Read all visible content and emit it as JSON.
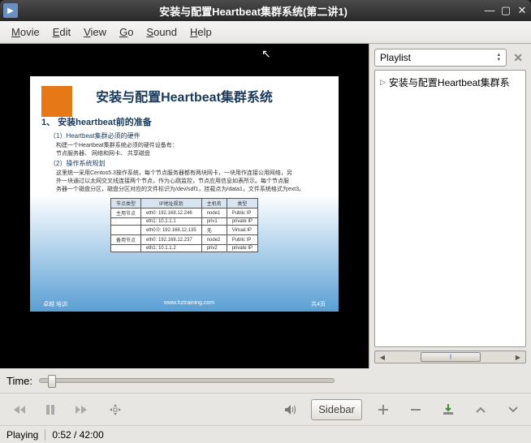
{
  "window": {
    "title": "安装与配置Heartbeat集群系统(第二讲1)"
  },
  "menu": {
    "movie": "Movie",
    "edit": "Edit",
    "view": "View",
    "go": "Go",
    "sound": "Sound",
    "help": "Help"
  },
  "slide": {
    "title": "安装与配置Heartbeat集群系统",
    "h1": "1、 安装heartbeat前的准备",
    "sec1": "（1）Heartbeat集群必须的硬件",
    "sec1_p": "构建一个Heartbeat集群系统必须的硬件设备有：",
    "sec1_p2": "节点服务器、 网络和网卡、 共享磁盘",
    "sec2": "（2）操作系统规划",
    "sec2_p1": "这里统一采用Centos5.3操作系统，每个节点服务器都有两块网卡，一块用作连接公用网络，另",
    "sec2_p2": "外一块通过以太网交叉线连接两个节点，作为心跳监控，节点应用信息如表所示。每个节点服",
    "sec2_p3": "务器一个磁盘分区，磁盘分区对应的文件标识为/dev/sdf1，挂载点为/data1，文件系统格式为ext3。",
    "table": {
      "headers": [
        "节点类型",
        "IP地址规划",
        "主机名",
        "类型"
      ],
      "rows": [
        [
          "主用节点",
          "eth0: 192.168.12.246",
          "node1",
          "Public IP"
        ],
        [
          "",
          "eth1: 10.1.1.1",
          "priv1",
          "private IP"
        ],
        [
          "",
          "eth0:0: 192.168.12.135",
          "无",
          "Virtual IP"
        ],
        [
          "备用节点",
          "eth0: 192.168.12.237",
          "node2",
          "Public IP"
        ],
        [
          "",
          "eth1: 10.1.1.2",
          "priv2",
          "private IP"
        ]
      ]
    },
    "footer_left": "卓越 培训",
    "footer_center": "www.hztraining.com",
    "footer_right": "共4页"
  },
  "playlist": {
    "label": "Playlist",
    "items": [
      "安装与配置Heartbeat集群系"
    ]
  },
  "timebar": {
    "label": "Time:"
  },
  "controls": {
    "sidebar_label": "Sidebar"
  },
  "status": {
    "state": "Playing",
    "time": "0:52 / 42:00"
  }
}
